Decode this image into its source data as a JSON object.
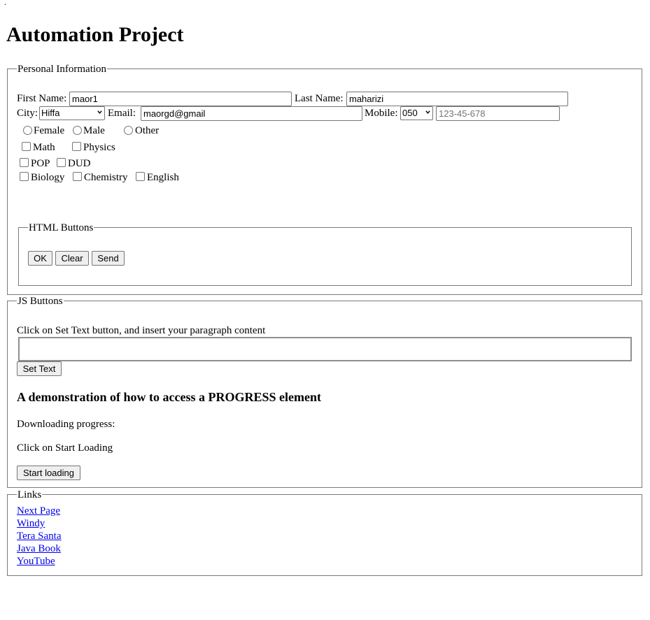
{
  "top_marker": ".",
  "page_title": "Automation Project",
  "personal": {
    "legend": "Personal Information",
    "first_name": {
      "label": "First Name:",
      "value": "maor1"
    },
    "last_name": {
      "label": "Last Name:",
      "value": "maharizi"
    },
    "city": {
      "label": "City:",
      "selected": "Hiffa"
    },
    "email": {
      "label": "Email:",
      "value": "maorgd@gmail"
    },
    "mobile": {
      "label": "Mobile:",
      "prefix": "050",
      "placeholder": "123-45-678"
    },
    "gender": [
      "Female",
      "Male",
      "Other"
    ],
    "subjects_row1": [
      "Math",
      "Physics"
    ],
    "subjects_row2": [
      "POP",
      "DUD"
    ],
    "subjects_row3": [
      "Biology",
      "Chemistry",
      "English"
    ],
    "html_buttons": {
      "legend": "HTML Buttons",
      "buttons": [
        "OK",
        "Clear",
        "Send"
      ]
    }
  },
  "js": {
    "legend": "JS Buttons",
    "instruction": "Click on Set Text button, and insert your paragraph content",
    "set_text": "Set Text",
    "progress_heading": "A demonstration of how to access a PROGRESS element",
    "downloading_label": "Downloading progress:",
    "click_hint": "Click on Start Loading",
    "start_loading": "Start loading"
  },
  "links": {
    "legend": "Links",
    "items": [
      "Next Page",
      "Windy",
      "Tera Santa",
      "Java Book",
      "YouTube"
    ]
  }
}
